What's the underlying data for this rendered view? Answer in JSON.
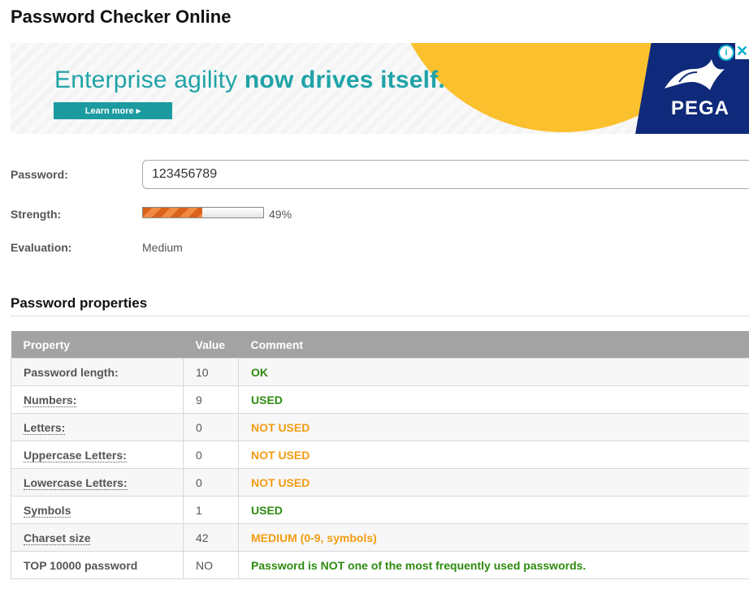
{
  "page": {
    "title": "Password Checker Online"
  },
  "ad": {
    "headline_part1": "Enterprise agility ",
    "headline_part2": "now drives itself.",
    "cta_label": "Learn more ▸",
    "brand": "PEGA",
    "info_glyph": "i",
    "close_glyph": "✕",
    "colors": {
      "teal": "#1fa3a8",
      "yellow": "#fbc02d",
      "navy": "#0f2a7a"
    }
  },
  "form": {
    "password_label": "Password:",
    "password_value": "123456789",
    "strength_label": "Strength:",
    "strength_percent": 49,
    "strength_text": "49%",
    "evaluation_label": "Evaluation:",
    "evaluation_value": "Medium"
  },
  "properties": {
    "title": "Password properties",
    "headers": {
      "property": "Property",
      "value": "Value",
      "comment": "Comment"
    },
    "rows": [
      {
        "property": "Password length:",
        "value": "10",
        "comment": "OK",
        "status": "ok"
      },
      {
        "property": "Numbers:",
        "value": "9",
        "comment": "USED",
        "status": "ok"
      },
      {
        "property": "Letters:",
        "value": "0",
        "comment": "NOT USED",
        "status": "warn"
      },
      {
        "property": "Uppercase Letters:",
        "value": "0",
        "comment": "NOT USED",
        "status": "warn"
      },
      {
        "property": "Lowercase Letters:",
        "value": "0",
        "comment": "NOT USED",
        "status": "warn"
      },
      {
        "property": "Symbols",
        "value": "1",
        "comment": "USED",
        "status": "ok"
      },
      {
        "property": "Charset size",
        "value": "42",
        "comment": "MEDIUM (0-9, symbols)",
        "status": "warn"
      },
      {
        "property": "TOP 10000 password",
        "value": "NO",
        "comment": "Password is NOT one of the most frequently used passwords.",
        "status": "ok"
      }
    ],
    "status_colors": {
      "ok": "#2e8b10",
      "warn": "#f39c12"
    }
  }
}
